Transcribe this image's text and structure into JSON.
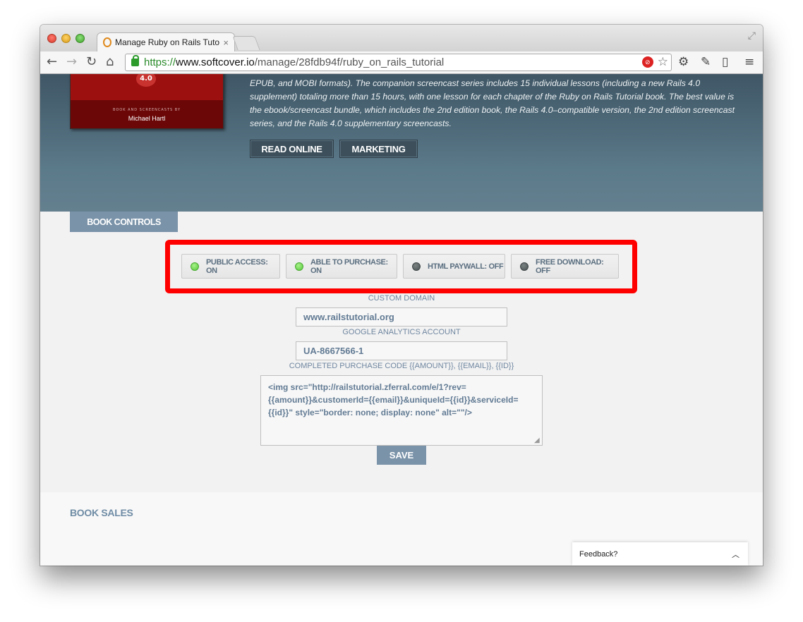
{
  "browser": {
    "tab_title": "Manage Ruby on Rails Tuto",
    "tab_close": "×",
    "url_scheme": "https://",
    "url_host": "www.softcover.io",
    "url_path": "/manage/28fdb94f/ruby_on_rails_tutorial"
  },
  "hero": {
    "cover": {
      "version": "4.0",
      "byline": "BOOK AND SCREENCASTS BY",
      "author": "Michael Hartl"
    },
    "description_lines": [
      "EPUB, and MOBI formats). The companion screencast series includes 15 individual lessons (including a new Rails 4.0",
      "supplement) totaling more than 15 hours, with one lesson for each chapter of the Ruby on Rails Tutorial book. The best value is",
      "the ebook/screencast bundle, which includes the 2nd edition book, the Rails 4.0–compatible version, the 2nd edition screencast",
      "series, and the Rails 4.0 supplementary screencasts."
    ],
    "read_online_label": "READ ONLINE",
    "marketing_label": "MARKETING"
  },
  "controls": {
    "tab_label": "BOOK CONTROLS",
    "toggles": [
      {
        "label": "PUBLIC ACCESS: ON",
        "state": "on"
      },
      {
        "label": "ABLE TO PURCHASE: ON",
        "state": "on"
      },
      {
        "label": "HTML PAYWALL: OFF",
        "state": "off"
      },
      {
        "label": "FREE DOWNLOAD: OFF",
        "state": "off"
      }
    ],
    "custom_domain_label": "CUSTOM DOMAIN",
    "custom_domain_value": "www.railstutorial.org",
    "analytics_label": "GOOGLE ANALYTICS ACCOUNT",
    "analytics_value": "UA-8667566-1",
    "purchase_code_label": "COMPLETED PURCHASE CODE {{AMOUNT}}, {{EMAIL}}, {{ID}}",
    "purchase_code_value": "<img src=\"http://railstutorial.zferral.com/e/1?rev={{amount}}&customerId={{email}}&uniqueId={{id}}&serviceId={{id}}\" style=\"border: none; display: none\" alt=\"\"/>",
    "save_label": "SAVE"
  },
  "sales": {
    "heading": "BOOK SALES"
  },
  "feedback": {
    "label": "Feedback?"
  },
  "colors": {
    "accent": "#7a93a9",
    "highlight": "#ff0000",
    "toggle_on": "#55c93a",
    "toggle_off": "#4b5354"
  }
}
